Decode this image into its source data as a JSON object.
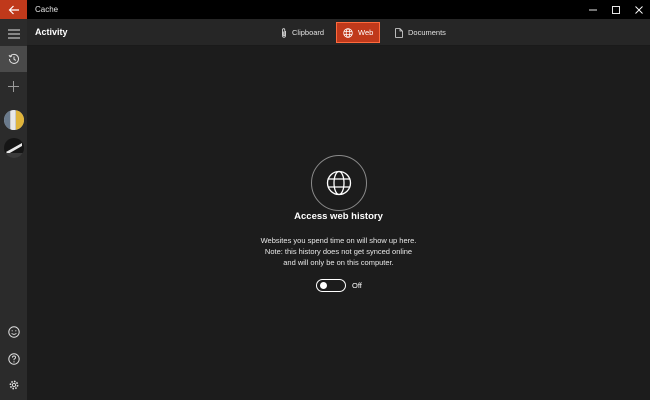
{
  "window": {
    "title": "Cache"
  },
  "header": {
    "title": "Activity",
    "tabs": [
      {
        "label": "Clipboard",
        "icon": "paperclip-icon",
        "selected": false
      },
      {
        "label": "Web",
        "icon": "globe-icon",
        "selected": true
      },
      {
        "label": "Documents",
        "icon": "document-icon",
        "selected": false
      }
    ]
  },
  "rail": {
    "items": [
      {
        "icon": "menu-icon"
      },
      {
        "icon": "history-icon",
        "active": true
      },
      {
        "icon": "plus-icon"
      },
      {
        "icon": "avatar-1"
      },
      {
        "icon": "avatar-2"
      },
      {
        "icon": "smiley-icon"
      },
      {
        "icon": "help-icon"
      },
      {
        "icon": "gear-icon"
      }
    ]
  },
  "main": {
    "icon": "globe-icon",
    "heading": "Access web history",
    "description_lines": [
      "Websites you spend time on will show up here.",
      "Note: this history does not get synced online",
      "and will only be on this computer."
    ],
    "toggle": {
      "state": "Off"
    }
  },
  "colors": {
    "accent": "#c0391b",
    "accent_border": "#ff6a3d",
    "background": "#1c1c1c",
    "rail": "#2b2b2b",
    "titlebar": "#000000"
  }
}
